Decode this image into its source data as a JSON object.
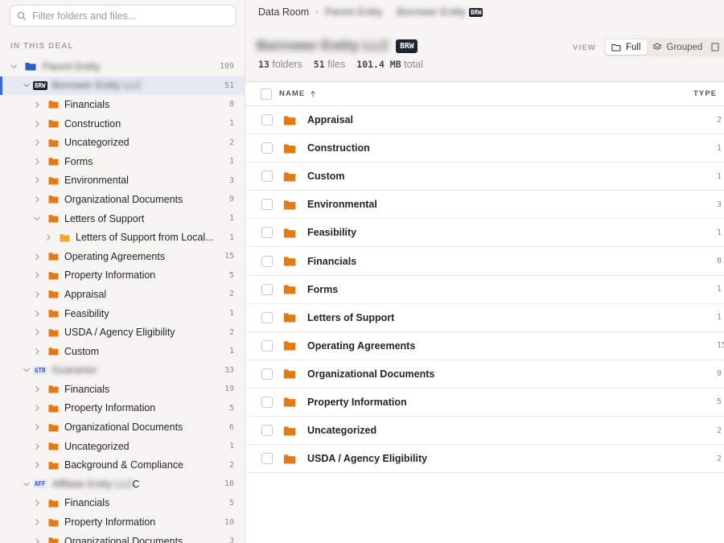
{
  "colors": {
    "folder": "#e37a14",
    "folder_light": "#f5a623",
    "selected_accent": "#3b66d6",
    "badge_dark": "#1d2433"
  },
  "sidebar": {
    "search_placeholder": "Filter folders and files...",
    "section_label": "IN THIS DEAL",
    "root": {
      "name": "Parent Entity",
      "count": "109"
    },
    "entities": [
      {
        "badge": "BRW",
        "name": "Borrower Entity LLC",
        "count": "51",
        "folders": [
          {
            "label": "Financials",
            "count": "8"
          },
          {
            "label": "Construction",
            "count": "1"
          },
          {
            "label": "Uncategorized",
            "count": "2"
          },
          {
            "label": "Forms",
            "count": "1"
          },
          {
            "label": "Environmental",
            "count": "3"
          },
          {
            "label": "Organizational Documents",
            "count": "9"
          },
          {
            "label": "Letters of Support",
            "count": "1"
          },
          {
            "label": "Letters of Support from Local...",
            "count": "1"
          },
          {
            "label": "Operating Agreements",
            "count": "15"
          },
          {
            "label": "Property Information",
            "count": "5"
          },
          {
            "label": "Appraisal",
            "count": "2"
          },
          {
            "label": "Feasibility",
            "count": "1"
          },
          {
            "label": "USDA / Agency Eligibility",
            "count": "2"
          },
          {
            "label": "Custom",
            "count": "1"
          }
        ]
      },
      {
        "badge": "GTR",
        "name": "Guarantor",
        "count": "33",
        "folders": [
          {
            "label": "Financials",
            "count": "19"
          },
          {
            "label": "Property Information",
            "count": "5"
          },
          {
            "label": "Organizational Documents",
            "count": "6"
          },
          {
            "label": "Uncategorized",
            "count": "1"
          },
          {
            "label": "Background & Compliance",
            "count": "2"
          }
        ]
      },
      {
        "badge": "AFF",
        "name": "Affiliate Entity LLC",
        "name_tail": "C",
        "count": "18",
        "folders": [
          {
            "label": "Financials",
            "count": "5"
          },
          {
            "label": "Property Information",
            "count": "10"
          },
          {
            "label": "Organizational Documents",
            "count": "3"
          }
        ]
      }
    ]
  },
  "main": {
    "breadcrumb": {
      "root": "Data Room",
      "level2": "Parent Entity",
      "level3": "Borrower Entity",
      "badge": "BRW"
    },
    "header": {
      "title": "Borrower Entity LLC",
      "badge": "BRW",
      "folders_count": "13",
      "folders_label": "folders",
      "files_count": "51",
      "files_label": "files",
      "size": "101.4 MB",
      "size_label": "total"
    },
    "view": {
      "label": "VIEW",
      "options": [
        "Full",
        "Grouped"
      ],
      "selected": "Full"
    },
    "table": {
      "columns": {
        "name": "NAME",
        "type": "TYPE"
      },
      "rows": [
        {
          "name": "Appraisal",
          "count": "2"
        },
        {
          "name": "Construction",
          "count": "1"
        },
        {
          "name": "Custom",
          "count": "1"
        },
        {
          "name": "Environmental",
          "count": "3"
        },
        {
          "name": "Feasibility",
          "count": "1"
        },
        {
          "name": "Financials",
          "count": "8"
        },
        {
          "name": "Forms",
          "count": "1"
        },
        {
          "name": "Letters of Support",
          "count": "1"
        },
        {
          "name": "Operating Agreements",
          "count": "15"
        },
        {
          "name": "Organizational Documents",
          "count": "9"
        },
        {
          "name": "Property Information",
          "count": "5"
        },
        {
          "name": "Uncategorized",
          "count": "2"
        },
        {
          "name": "USDA / Agency Eligibility",
          "count": "2"
        }
      ]
    }
  }
}
